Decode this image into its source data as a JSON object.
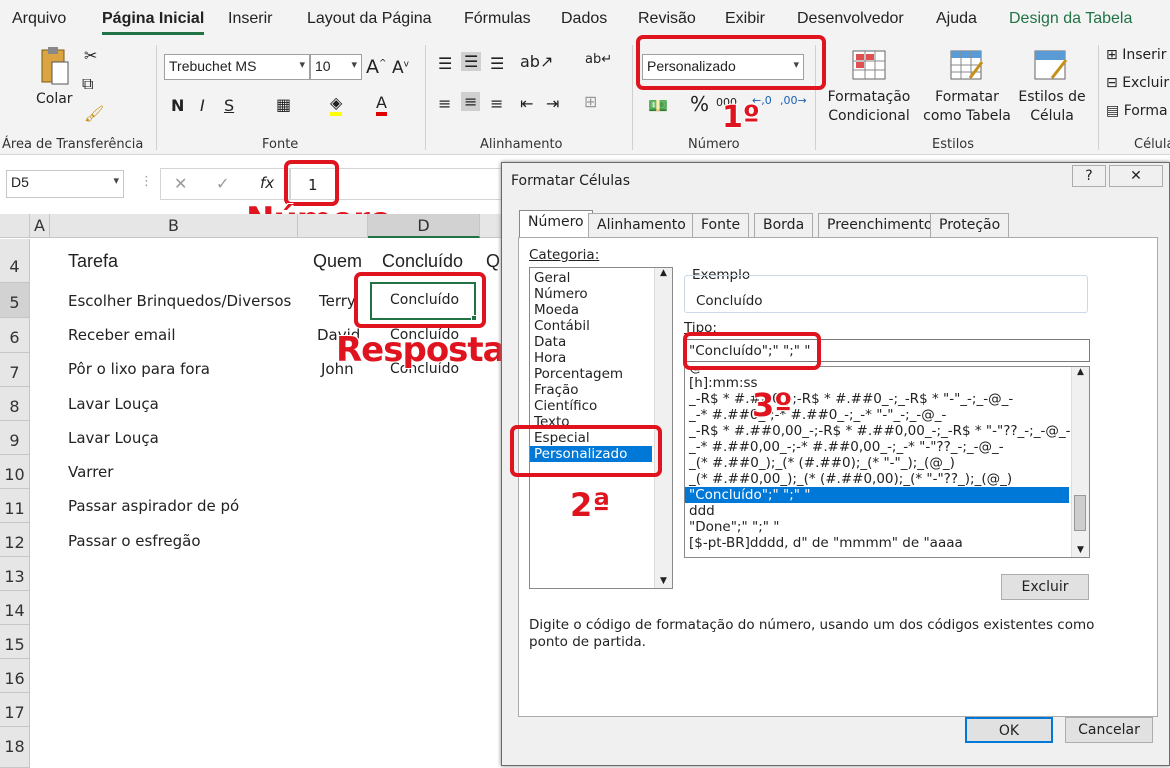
{
  "menu": {
    "tabs": [
      "Arquivo",
      "Página Inicial",
      "Inserir",
      "Layout da Página",
      "Fórmulas",
      "Dados",
      "Revisão",
      "Exibir",
      "Desenvolvedor",
      "Ajuda",
      "Design da Tabela"
    ]
  },
  "ribbon": {
    "clipboard": {
      "paste_label": "Colar",
      "group": "Área de Transferência"
    },
    "font": {
      "name": "Trebuchet MS",
      "size": "10",
      "bold": "N",
      "italic": "I",
      "underline": "S",
      "group": "Fonte"
    },
    "alignment": {
      "group": "Alinhamento"
    },
    "number": {
      "format": "Personalizado",
      "percent": "%",
      "thousands": "000",
      "group": "Número"
    },
    "styles": {
      "conditional": "Formatação Condicional",
      "format_table": "Formatar como Tabela",
      "cell_styles": "Estilos de Célula",
      "group": "Estilos"
    },
    "cells": {
      "insert": "Inserir",
      "delete": "Excluir",
      "format": "Forma",
      "group": "Célula"
    }
  },
  "formula_bar": {
    "name_box": "D5",
    "fx": "fx",
    "value": "1"
  },
  "annotations": {
    "numero": "Número",
    "resposta": "Resposta",
    "first": "1º",
    "second": "2ª",
    "third": "3º"
  },
  "sheet": {
    "columns": [
      "A",
      "B",
      "D"
    ],
    "rows": [
      "4",
      "5",
      "6",
      "7",
      "8",
      "9",
      "10",
      "11",
      "12",
      "13",
      "14",
      "15",
      "16",
      "17",
      "18"
    ],
    "headers": {
      "tarefa": "Tarefa",
      "quem": "Quem",
      "concluido": "Concluído",
      "q": "Q"
    },
    "tasks": [
      "Escolher Brinquedos/Diversos",
      "Receber email",
      "Pôr o lixo para fora",
      "Lavar Louça",
      "Lavar Louça",
      "Varrer",
      "Passar aspirador de pó",
      "Passar o esfregão"
    ],
    "who": [
      "Terry",
      "David",
      "John"
    ],
    "done": [
      "Concluído",
      "Concluído",
      "Concluído"
    ]
  },
  "dialog": {
    "title": "Formatar Células",
    "help": "?",
    "close": "✕",
    "tabs": [
      "Número",
      "Alinhamento",
      "Fonte",
      "Borda",
      "Preenchimento",
      "Proteção"
    ],
    "category_label": "Categoria:",
    "categories": [
      "Geral",
      "Número",
      "Moeda",
      "Contábil",
      "Data",
      "Hora",
      "Porcentagem",
      "Fração",
      "Científico",
      "Texto",
      "Especial",
      "Personalizado"
    ],
    "sample_label": "Exemplo",
    "sample_value": "Concluído",
    "type_label": "Tipo:",
    "type_value": "\"Concluído\";\" \";\" \"",
    "type_list": [
      "@",
      "[h]:mm:ss",
      "_-R$ * #.##0_-;-R$ * #.##0_-;_-R$ * \"-\"_-;_-@_-",
      "_-* #.##0_-;-* #.##0_-;_-* \"-\"_-;_-@_-",
      "_-R$ * #.##0,00_-;-R$ * #.##0,00_-;_-R$ * \"-\"??_-;_-@_-",
      "_-* #.##0,00_-;-* #.##0,00_-;_-* \"-\"??_-;_-@_-",
      "_(* #.##0_);_(* (#.##0);_(* \"-\"_);_(@_)",
      "_(* #.##0,00_);_(* (#.##0,00);_(* \"-\"??_);_(@_)",
      "\"Concluído\";\" \";\" \"",
      "ddd",
      "\"Done\";\" \";\" \"",
      "[$-pt-BR]dddd, d\" de \"mmmm\" de \"aaaa"
    ],
    "delete_button": "Excluir",
    "description": "Digite o código de formatação do número, usando um dos códigos existentes como ponto de partida.",
    "ok": "OK",
    "cancel": "Cancelar"
  },
  "colors": {
    "accent": "#217346",
    "annotation": "#e0141e",
    "selection": "#0078d7"
  }
}
